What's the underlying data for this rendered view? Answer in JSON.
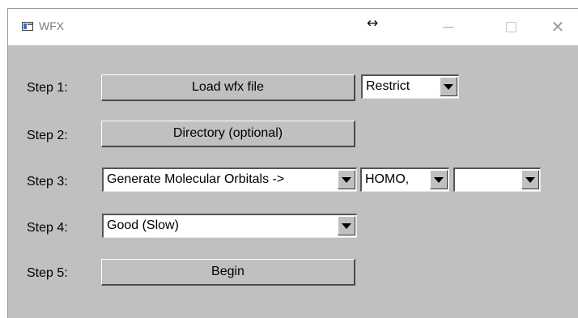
{
  "window": {
    "title": "WFX"
  },
  "titlebar": {
    "resize_glyph": "↔",
    "minimize_glyph": "—",
    "close_glyph": "✕"
  },
  "steps": {
    "step1": {
      "label": "Step 1:",
      "button": "Load wfx file",
      "select": "Restrict"
    },
    "step2": {
      "label": "Step 2:",
      "button": "Directory (optional)"
    },
    "step3": {
      "label": "Step 3:",
      "select1": "Generate Molecular Orbitals ->",
      "select2": "HOMO,",
      "select3": ""
    },
    "step4": {
      "label": "Step 4:",
      "select": "Good (Slow)"
    },
    "step5": {
      "label": "Step 5:",
      "button": "Begin"
    }
  },
  "colors": {
    "background": "#c0c0c0",
    "titlebar": "#ffffff",
    "field": "#ffffff"
  },
  "icons": [
    "app-icon",
    "resize-icon",
    "minimize-icon",
    "maximize-icon",
    "close-icon",
    "dropdown-arrow-icon"
  ]
}
